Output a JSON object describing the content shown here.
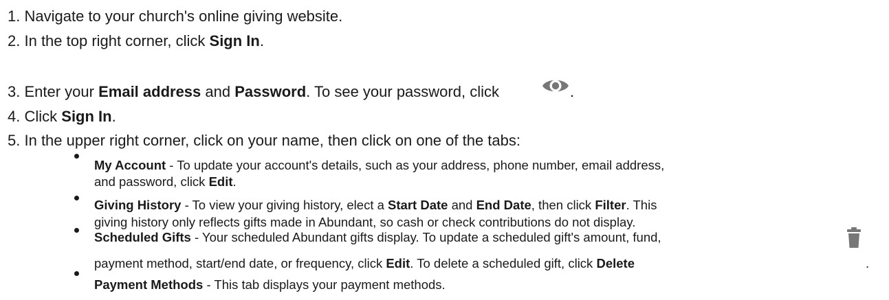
{
  "steps": [
    {
      "number": "1.",
      "text": "Navigate to your church's online giving website."
    },
    {
      "number": "2.",
      "text_a": "In the top right corner, click ",
      "bold_a": "Sign In",
      "text_b": "."
    },
    {
      "number": "3.",
      "text_a": "Enter your ",
      "bold_a": "Email address",
      "text_b": " and ",
      "bold_b": "Password",
      "text_c": ". To see your password, click ",
      "icon": "eye-icon",
      "text_d": "."
    },
    {
      "number": "4.",
      "text_a": "Click ",
      "bold_a": "Sign In",
      "text_b": "."
    },
    {
      "number": "5.",
      "text": "In the upper right corner, click on your name, then click on one of the tabs:"
    }
  ],
  "tabs": {
    "my_account": {
      "title": "My Account",
      "line1": " - To update your account's details, such as your address, phone number, email address,",
      "line2_a": "and password, click ",
      "line2_bold": "Edit",
      "line2_b": "."
    },
    "giving_history": {
      "title": "Giving History",
      "line1_a": " - To view your giving history, elect a ",
      "line1_bold_a": "Start Date",
      "line1_b": " and ",
      "line1_bold_b": "End Date",
      "line1_c": ", then click ",
      "line1_bold_c": "Filter",
      "line1_d": ". This",
      "line2": "giving history only reflects gifts made in Abundant, so cash or check contributions do not display."
    },
    "scheduled_gifts": {
      "title": "Scheduled Gifts",
      "line1": " - Your scheduled Abundant gifts display. To update a scheduled gift's amount, fund,",
      "line2_a": "payment method, start/end date, or frequency, click ",
      "line2_bold_a": "Edit",
      "line2_b": ". To delete a scheduled gift, click ",
      "line2_bold_b": "Delete",
      "icon": "trash-icon",
      "line2_c": "."
    },
    "payment_methods": {
      "title": "Payment Methods",
      "line1": " - This tab displays your payment methods."
    }
  },
  "colors": {
    "text": "#1a1a1a",
    "icon": "#777777"
  }
}
